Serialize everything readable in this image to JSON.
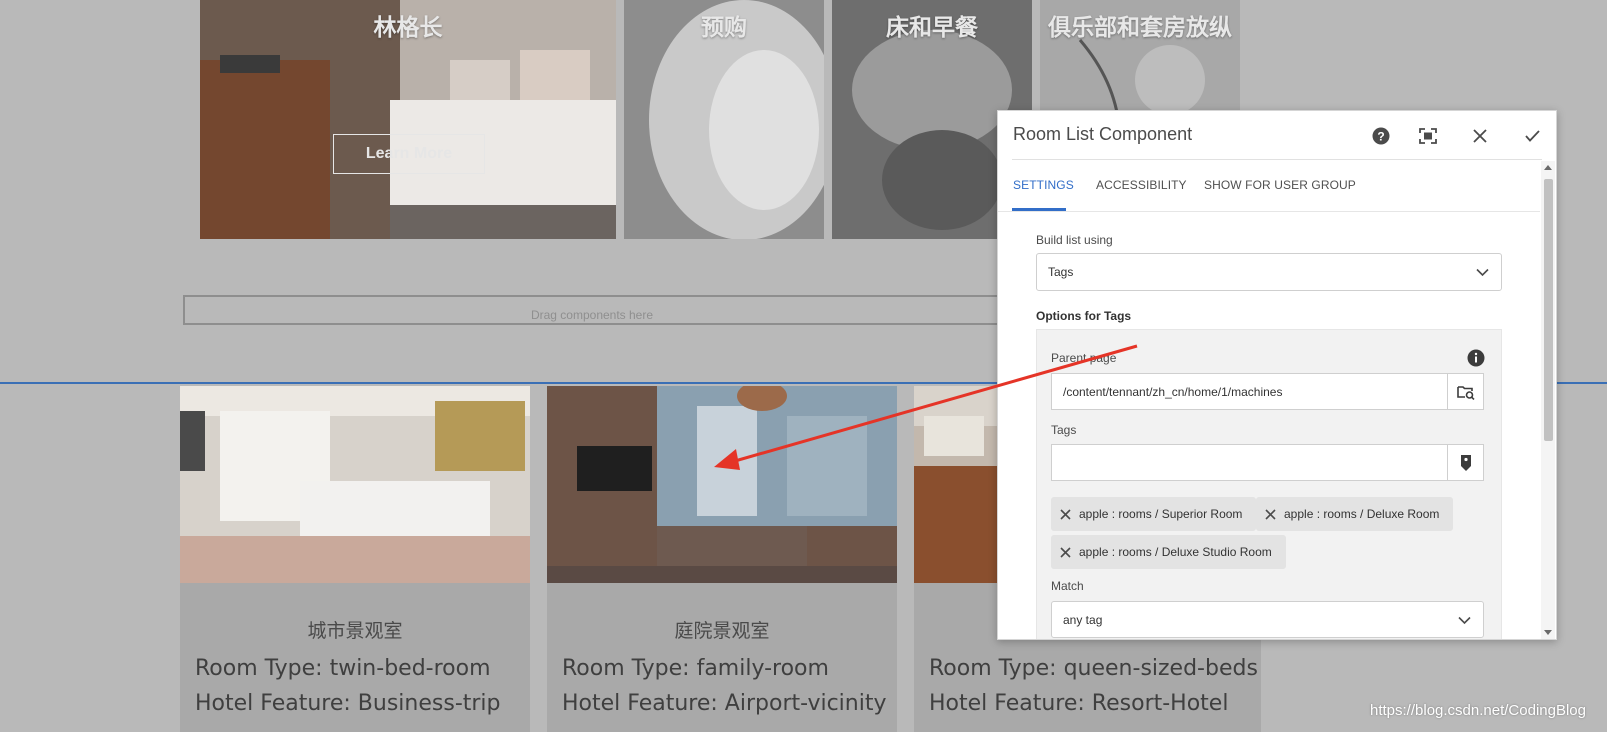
{
  "hero_tiles": [
    {
      "title": "林格长",
      "button": "Learn More"
    },
    {
      "title": "预购"
    },
    {
      "title": "床和早餐"
    },
    {
      "title": "俱乐部和套房放纵"
    }
  ],
  "drop_zone": {
    "label": "Drag components here"
  },
  "cards": [
    {
      "title": "城市景观室",
      "room_type": "Room Type: twin-bed-room",
      "feature": "Hotel Feature: Business-trip"
    },
    {
      "title": "庭院景观室",
      "room_type": "Room Type: family-room",
      "feature": "Hotel Feature: Airport-vicinity"
    },
    {
      "title": "",
      "room_type": "Room Type: queen-sized-beds",
      "feature": "Hotel Feature: Resort-Hotel"
    }
  ],
  "dialog": {
    "title": "Room List Component",
    "header_icons": [
      "help-icon",
      "fullscreen-icon",
      "close-icon",
      "check-icon"
    ],
    "tabs": [
      "SETTINGS",
      "ACCESSIBILITY",
      "SHOW FOR USER GROUP"
    ],
    "active_tab": "SETTINGS",
    "build_list_label": "Build list using",
    "build_list_value": "Tags",
    "options_title": "Options for Tags",
    "parent_page_label": "Parent page",
    "parent_page_value": "/content/tennant/zh_cn/home/1/machines",
    "tags_label": "Tags",
    "tags_value": "",
    "chips": [
      "apple : rooms / Superior Room",
      "apple : rooms / Deluxe Room",
      "apple : rooms / Deluxe Studio Room"
    ],
    "match_label": "Match",
    "match_value": "any tag"
  },
  "watermark": "https://blog.csdn.net/CodingBlog",
  "colors": {
    "accent": "#326ec8",
    "annotation_arrow": "#e53427",
    "overlay_gray": "#b9b9b9"
  }
}
